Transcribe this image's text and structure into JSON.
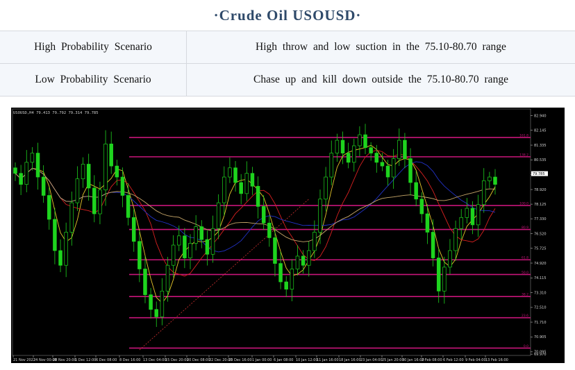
{
  "page": {
    "title": "·Crude   Oil   USOUSD·"
  },
  "scenarios": [
    {
      "label": "High Probability Scenario",
      "text": "High throw and low suction in the 75.10-80.70 range"
    },
    {
      "label": "Low Probability Scenario",
      "text": "Chase up and kill down outside the 75.10-80.70 range"
    }
  ],
  "chart_data": {
    "type": "candlestick",
    "header": "USOUSD,H4  79.413 79.792 79.314 79.785",
    "current_price": "79.785",
    "y_ticks": [
      "82.940",
      "82.145",
      "81.335",
      "80.535",
      "79.735",
      "78.920",
      "78.125",
      "77.330",
      "76.520",
      "75.725",
      "74.920",
      "74.115",
      "73.310",
      "72.510",
      "71.710",
      "70.905",
      "70.095",
      "69.970"
    ],
    "y_range": [
      69.9,
      83.3
    ],
    "x_ticks": [
      "21 Nov 2022",
      "24 Nov 00:00",
      "28 Nov 20:00",
      "1 Dec 12:00",
      "6 Dec 08:00",
      "8 Dec 16:00",
      "13 Dec 04:00",
      "15 Dec 20:00",
      "20 Dec 08:00",
      "22 Dec 20:00",
      "23 Dec 16:00",
      "1 Jan 00:00",
      "6 Jan 08:00",
      "10 Jan 12:00",
      "11 Jan 16:00",
      "18 Jan 16:00",
      "23 Jan 04:00",
      "25 Jan 20:00",
      "30 Jan 16:00",
      "2 Feb 08:00",
      "6 Feb 12:00",
      "9 Feb 04:00",
      "13 Feb 16:00"
    ],
    "levels": [
      {
        "price": 81.75,
        "label": "161.8"
      },
      {
        "price": 80.7,
        "label": "138.2"
      },
      {
        "price": 78.05,
        "label": "100.0"
      },
      {
        "price": 76.75,
        "label": "80.9"
      },
      {
        "price": 75.1,
        "label": "61.8"
      },
      {
        "price": 74.3,
        "label": "50.0"
      },
      {
        "price": 73.1,
        "label": "38.2"
      },
      {
        "price": 71.95,
        "label": "23.6"
      },
      {
        "price": 70.3,
        "label": "0.0"
      }
    ],
    "closes": [
      79.8,
      79.2,
      80.4,
      80.9,
      79.6,
      78.6,
      77.3,
      75.6,
      74.8,
      76.6,
      78.2,
      79.5,
      80.3,
      79.0,
      77.6,
      78.9,
      81.4,
      80.2,
      79.6,
      78.6,
      77.4,
      76.1,
      74.6,
      73.2,
      72.4,
      72.0,
      73.4,
      74.8,
      75.9,
      76.4,
      75.2,
      76.0,
      76.9,
      76.2,
      75.4,
      76.8,
      78.2,
      79.6,
      80.1,
      79.3,
      78.7,
      79.8,
      79.1,
      78.0,
      77.1,
      76.3,
      74.9,
      73.9,
      73.5,
      74.6,
      75.3,
      74.8,
      75.6,
      76.6,
      78.4,
      79.6,
      80.9,
      81.6,
      80.9,
      80.4,
      81.3,
      81.9,
      81.2,
      80.9,
      80.4,
      80.2,
      79.6,
      80.6,
      81.6,
      80.6,
      79.3,
      78.4,
      77.6,
      76.6,
      75.2,
      73.4,
      74.7,
      75.6,
      76.8,
      77.4,
      77.9,
      77.0,
      78.1,
      79.4,
      79.6,
      79.2
    ],
    "indicators": [
      "sma-fast",
      "sma-mid",
      "ema-slow",
      "sma-slow"
    ]
  }
}
